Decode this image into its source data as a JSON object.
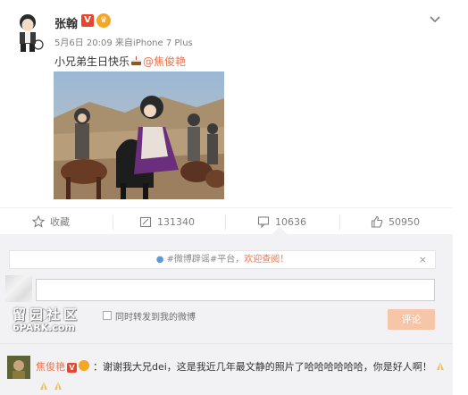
{
  "post": {
    "username": "张翰",
    "verified_badge": "V",
    "timestamp": "5月6日 20:09",
    "source_prefix": "来自",
    "source_device": "iPhone 7 Plus",
    "text_before": "小兄弟生日快乐",
    "mention": "@焦俊艳",
    "icons": [
      "avatar",
      "verified-icon",
      "crown-icon",
      "chevron-down-icon",
      "cake-emoji"
    ]
  },
  "actions": {
    "favorite_label": "收藏",
    "repost_count": "131340",
    "comment_count": "10636",
    "like_count": "50950"
  },
  "comment_box": {
    "notice_tag": "#微博辟谣#",
    "notice_text": "平台，",
    "notice_highlight": "欢迎查阅！",
    "close_symbol": "×",
    "also_repost_label": "同时转发到我的微博",
    "submit_label": "评论"
  },
  "watermark": {
    "line1": "留园社区",
    "line2": "6PARK.com"
  },
  "comment": {
    "author": "焦俊艳",
    "verified_badge": "V",
    "body": "：谢谢我大兄dei，这是我近几年最文静的照片了哈哈哈哈哈哈，你是好人啊！"
  },
  "colors": {
    "accent": "#eb7350",
    "verified": "#e8452c",
    "muted": "#808080",
    "comment_bg": "#f2f2f5"
  }
}
